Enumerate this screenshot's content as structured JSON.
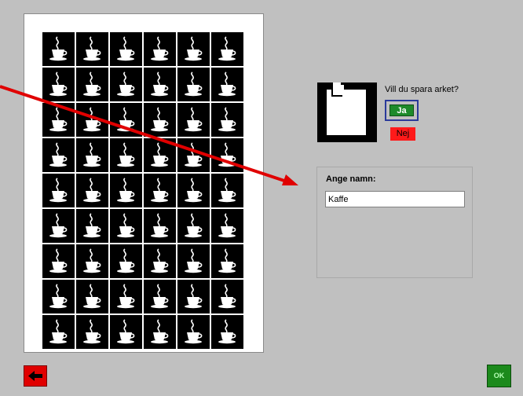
{
  "sheet": {
    "rows": 9,
    "columns": 6,
    "tile_icon": "coffee-cup-icon",
    "tile_background": "#000000",
    "tile_foreground": "#ffffff"
  },
  "save_dialog": {
    "disk_icon": "floppy-disk-icon",
    "question": "Vill du spara arket?",
    "yes_label": "Ja",
    "no_label": "Nej"
  },
  "name_panel": {
    "label": "Ange namn:",
    "value": "Kaffe"
  },
  "annotation": {
    "icon": "red-arrow-icon",
    "color": "#e00000"
  },
  "footer": {
    "back_icon": "arrow-left-icon",
    "ok_label": "OK"
  },
  "colors": {
    "background": "#c0c0c0",
    "yes_button": "#1d8a2a",
    "no_button": "#ff1a1a",
    "ok_button": "#1c8a1c",
    "back_button": "#e00000"
  }
}
